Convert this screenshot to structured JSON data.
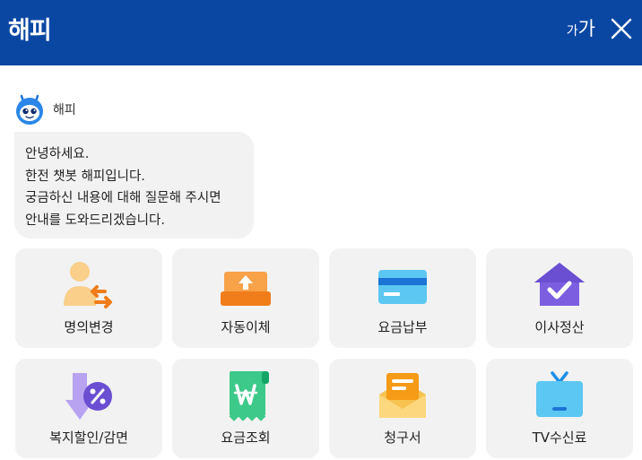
{
  "header": {
    "title": "해피",
    "font_small": "가",
    "font_large": "가",
    "bg_color": "#0a47a3"
  },
  "bot": {
    "name": "해피",
    "avatar_icon": "robot-avatar-icon"
  },
  "message": {
    "lines": [
      "안녕하세요.",
      "한전 챗봇 해피입니다.",
      "궁금하신 내용에 대해 질문해 주시면",
      "안내를 도와드리겠습니다."
    ]
  },
  "menu": [
    {
      "label": "명의변경",
      "icon": "name-change-icon"
    },
    {
      "label": "자동이체",
      "icon": "auto-transfer-icon"
    },
    {
      "label": "요금납부",
      "icon": "card-payment-icon"
    },
    {
      "label": "이사정산",
      "icon": "house-check-icon"
    },
    {
      "label": "복지할인/감면",
      "icon": "discount-arrow-icon"
    },
    {
      "label": "요금조회",
      "icon": "won-receipt-icon"
    },
    {
      "label": "청구서",
      "icon": "envelope-bill-icon"
    },
    {
      "label": "TV수신료",
      "icon": "tv-icon"
    }
  ]
}
